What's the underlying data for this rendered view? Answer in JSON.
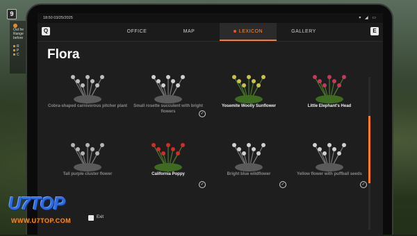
{
  "hud": {
    "badge": "9",
    "quest_lines": [
      "Out he",
      "Range",
      "before"
    ],
    "quest_bullets": [
      "R",
      "P",
      "C"
    ]
  },
  "statusbar": {
    "time": "18:50  03/25/2025",
    "icons": "▾ ◢ ▭"
  },
  "navbar": {
    "left_key": "Q",
    "right_key": "E",
    "tabs": [
      {
        "label": "OFFICE",
        "active": false
      },
      {
        "label": "MAP",
        "active": false
      },
      {
        "label": "LEXICON",
        "active": true
      },
      {
        "label": "GALLERY",
        "active": false
      }
    ]
  },
  "page_title": "Flora",
  "flora": [
    {
      "name": "Cobra-shaped carnivorous pitcher plant",
      "discovered": false,
      "checked": false,
      "icon": "pitcher-plant-icon",
      "color": "#bdbdbd"
    },
    {
      "name": "Small rosette succulent with bright flowers",
      "discovered": false,
      "checked": true,
      "icon": "succulent-icon",
      "color": "#cfcfcf"
    },
    {
      "name": "Yosemite Woolly Sunflower",
      "discovered": true,
      "checked": false,
      "icon": "woolly-sunflower-icon",
      "color": "#c9c24a"
    },
    {
      "name": "Little Elephant's Head",
      "discovered": true,
      "checked": false,
      "icon": "elephant-head-icon",
      "color": "#c23a5a"
    },
    {
      "name": "Tall purple cluster flower",
      "discovered": false,
      "checked": false,
      "icon": "cluster-flower-icon",
      "color": "#b5b5b5"
    },
    {
      "name": "California Poppy",
      "discovered": true,
      "checked": true,
      "icon": "poppy-icon",
      "color": "#d32a2a"
    },
    {
      "name": "Bright blue wildflower",
      "discovered": false,
      "checked": true,
      "icon": "blue-wildflower-icon",
      "color": "#d0d0d0"
    },
    {
      "name": "Yellow flower with puffball seeds",
      "discovered": false,
      "checked": true,
      "icon": "puffball-icon",
      "color": "#d0d0d0"
    }
  ],
  "exit": {
    "label": "Exit"
  },
  "watermark": {
    "brand": "U7TOP",
    "url": "WWW.U7TOP.COM"
  },
  "colors": {
    "accent": "#ff7a2a",
    "panel": "#1e1e1e"
  }
}
